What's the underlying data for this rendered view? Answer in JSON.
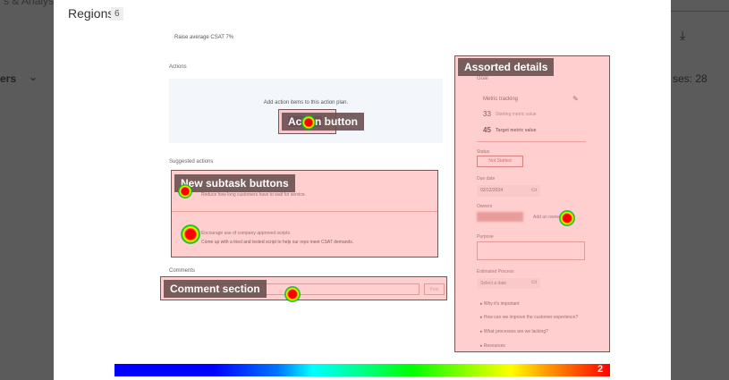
{
  "background": {
    "top_left_text": "s & Analysis",
    "filter_text": "ers",
    "cases_text": "ses: 28"
  },
  "header": {
    "title": "Regions",
    "count": "6"
  },
  "plan": {
    "goal": "Raise average CSAT 7%",
    "actions_heading": "Actions",
    "actions_empty": "Add action items to this action plan.",
    "suggested_heading": "Suggested actions",
    "suggested": [
      {
        "title": "Reduce how long customers have to wait for service."
      },
      {
        "title": "Encourage use of company approved scripts.",
        "desc": "Come up with a tried and tested script to help our reps meet CSAT demands."
      }
    ],
    "comments_heading": "Comments",
    "post_label": "Post"
  },
  "details": {
    "section_label": "Goal",
    "metric_tracking": "Metric tracking",
    "starting_value": "33",
    "starting_label": "Starting metric value",
    "target_value": "45",
    "target_label": "Target metric value",
    "status_label": "Status",
    "status_value": "Not Started",
    "due_label": "Due date",
    "due_value": "02/12/2024",
    "owners_label": "Owners",
    "add_owner": "Add an owner",
    "purpose_label": "Purpose",
    "process_label": "Estimated Process",
    "process_placeholder": "Select a date",
    "accordions": [
      "Why it's important",
      "How can we improve the customer experience?",
      "What processes are we lacking?",
      "Resources"
    ]
  },
  "regions": {
    "action": "Action button",
    "subtask": "New subtask buttons",
    "comment": "Comment section",
    "details": "Assorted details"
  },
  "legend": {
    "max": "2"
  }
}
